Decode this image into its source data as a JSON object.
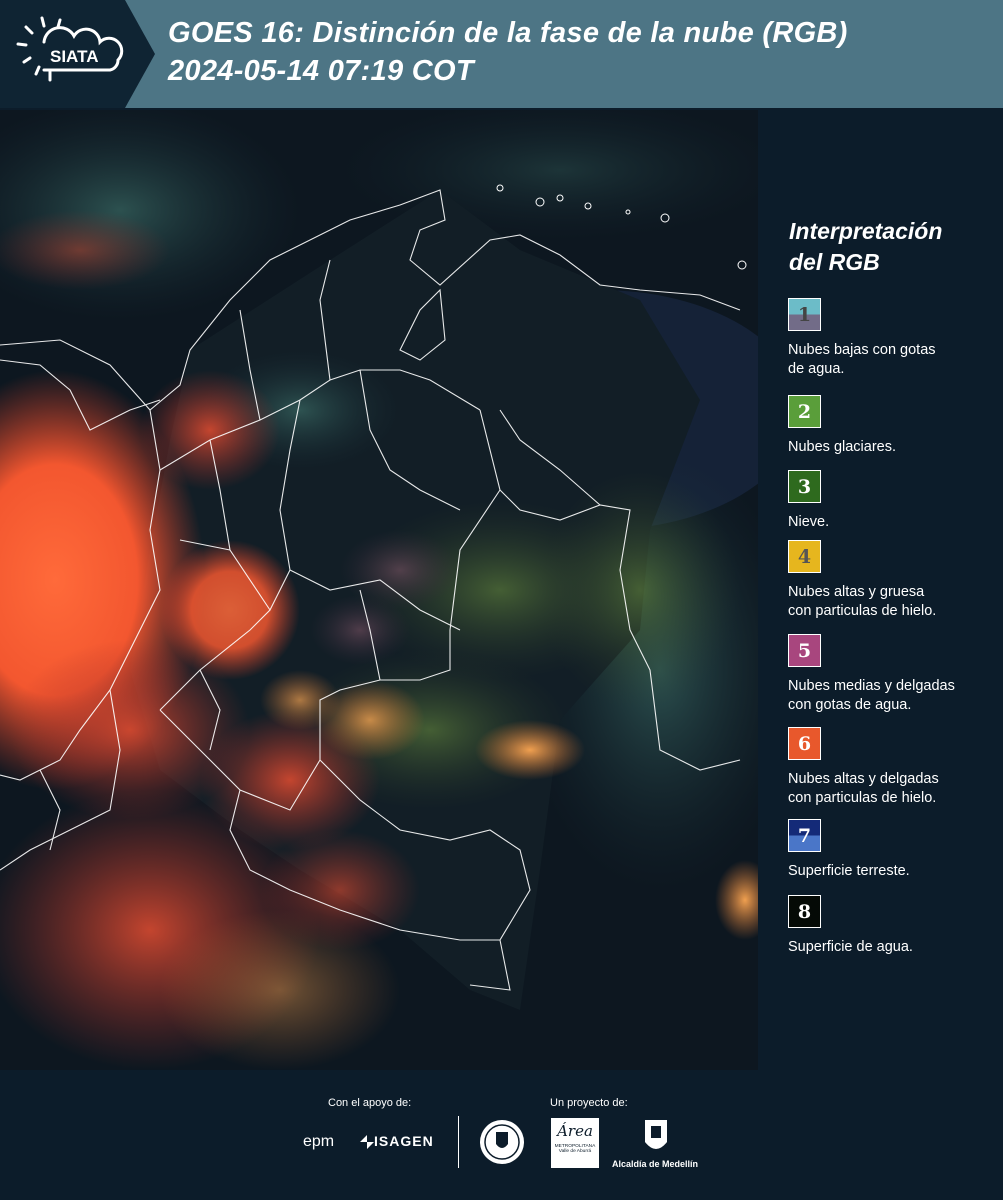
{
  "header": {
    "logo_text": "SIATA",
    "title_line1": "GOES 16: Distinción de la fase de la nube (RGB)",
    "title_line2": " 2024-05-14 07:19 COT",
    "bg_color": "#4d7585"
  },
  "legend": {
    "title_line1": "Interpretación",
    "title_line2": "del RGB",
    "items": [
      {
        "num": "1",
        "label_lines": [
          "Nubes bajas con gotas",
          "de agua."
        ],
        "colors": [
          "#6cbcc8",
          "#726c88"
        ]
      },
      {
        "num": "2",
        "label_lines": [
          "Nubes glaciares."
        ],
        "colors": [
          "#5a9e3a",
          "#5a9e3a"
        ]
      },
      {
        "num": "3",
        "label_lines": [
          "Nieve."
        ],
        "colors": [
          "#2e6a1e",
          "#2e6a1e"
        ]
      },
      {
        "num": "4",
        "label_lines": [
          "Nubes altas y gruesa",
          "con particulas de hielo."
        ],
        "colors": [
          "#e6b61e",
          "#e6b61e"
        ]
      },
      {
        "num": "5",
        "label_lines": [
          "Nubes medias y delgadas",
          "con gotas de agua."
        ],
        "colors": [
          "#a8467e",
          "#a8467e"
        ]
      },
      {
        "num": "6",
        "label_lines": [
          "Nubes altas y delgadas",
          "con particulas de hielo."
        ],
        "colors": [
          "#e8582c",
          "#e8582c"
        ]
      },
      {
        "num": "7",
        "label_lines": [
          "Superficie terreste."
        ],
        "colors": [
          "#142a78",
          "#4a76c8"
        ]
      },
      {
        "num": "8",
        "label_lines": [
          "Superficie de agua."
        ],
        "colors": [
          "#050a06",
          "#050a06"
        ]
      }
    ]
  },
  "footer": {
    "support_label": "Con el apoyo de:",
    "project_label": "Un proyecto de:",
    "sponsor1": "epm",
    "sponsor2": "ISAGEN",
    "partner1_lines": [
      "Área",
      "METROPOLITANA",
      "Valle de Aburrá"
    ],
    "partner2": "Alcaldía de Medellín"
  }
}
